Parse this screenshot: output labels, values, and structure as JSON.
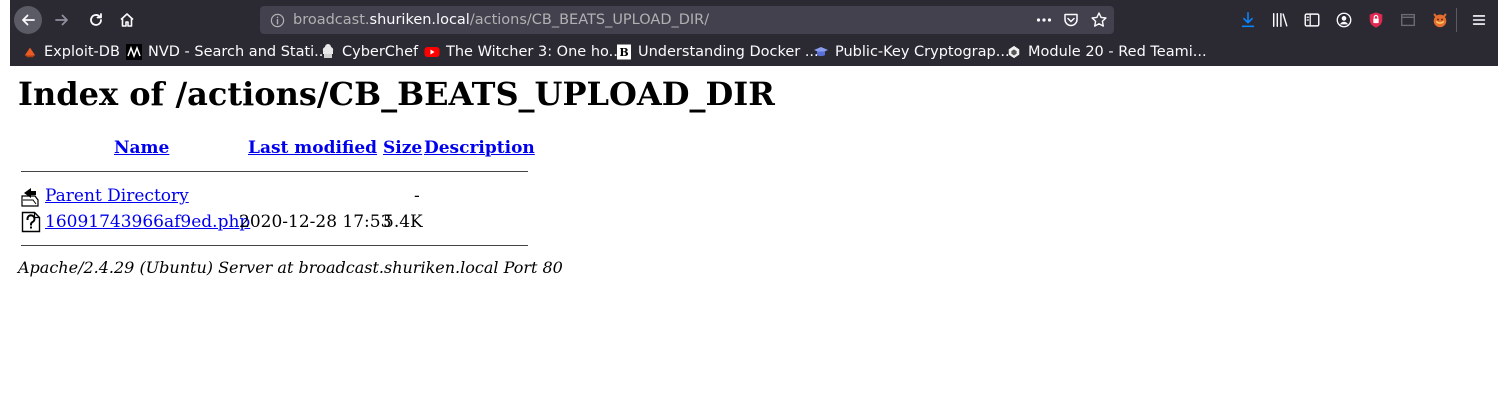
{
  "browser": {
    "url_prefix": "broadcast.",
    "url_host": "shuriken.local",
    "url_path": "/actions/CB_BEATS_UPLOAD_DIR/",
    "bookmarks": [
      {
        "label": "Exploit-DB",
        "icon": "exploit-db-icon"
      },
      {
        "label": "NVD - Search and Stati...",
        "icon": "nvd-icon"
      },
      {
        "label": "CyberChef",
        "icon": "cyberchef-icon"
      },
      {
        "label": "The Witcher 3: One ho...",
        "icon": "youtube-icon"
      },
      {
        "label": "Understanding Docker ...",
        "icon": "docker-article-icon"
      },
      {
        "label": "Public-Key Cryptograp...",
        "icon": "cryptography-icon"
      },
      {
        "label": "Module 20 - Red Teami...",
        "icon": "module-icon"
      }
    ]
  },
  "page": {
    "title": "Index of /actions/CB_BEATS_UPLOAD_DIR",
    "columns": {
      "name": "Name",
      "last_modified": "Last modified",
      "size": "Size",
      "description": "Description"
    },
    "rows": [
      {
        "name": "Parent Directory",
        "last_modified": "",
        "size": "-",
        "icon": "back-folder-icon"
      },
      {
        "name": "16091743966af9ed.php",
        "last_modified": "2020-12-28 17:53",
        "size": "5.4K",
        "icon": "unknown-file-icon"
      }
    ],
    "address": "Apache/2.4.29 (Ubuntu) Server at broadcast.shuriken.local Port 80"
  },
  "colors": {
    "chrome_bg": "#2b2a33",
    "url_bar_bg": "#42414d",
    "link": "#0000ee",
    "download_accent": "#0a84ff"
  }
}
